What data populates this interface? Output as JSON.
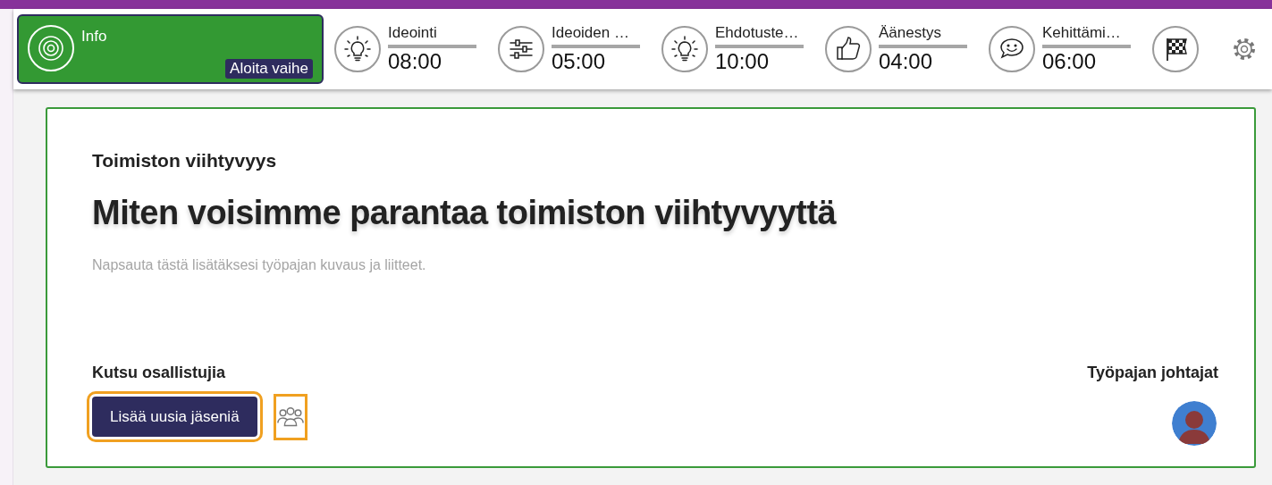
{
  "phases": [
    {
      "kind": "info",
      "title": "Info",
      "action": "Aloita vaihe",
      "selected": true
    },
    {
      "kind": "idea",
      "title": "Ideointi",
      "time": "08:00",
      "selected": false
    },
    {
      "kind": "sort",
      "title": "Ideoiden …",
      "time": "05:00",
      "selected": false
    },
    {
      "kind": "idea",
      "title": "Ehdotuste…",
      "time": "10:00",
      "selected": false
    },
    {
      "kind": "vote",
      "title": "Äänestys",
      "time": "04:00",
      "selected": false
    },
    {
      "kind": "comment",
      "title": "Kehittämi…",
      "time": "06:00",
      "selected": false
    },
    {
      "kind": "finish",
      "selected": false
    }
  ],
  "workshop": {
    "topic": "Toimiston viihtyvyys",
    "question": "Miten voisimme parantaa toimiston viihtyvyyttä",
    "description_placeholder": "Napsauta tästä lisätäksesi työpajan kuvaus ja liitteet."
  },
  "invite": {
    "heading": "Kutsu osallistujia",
    "button": "Lisää uusia jäseniä"
  },
  "leaders": {
    "heading": "Työpajan johtajat"
  }
}
